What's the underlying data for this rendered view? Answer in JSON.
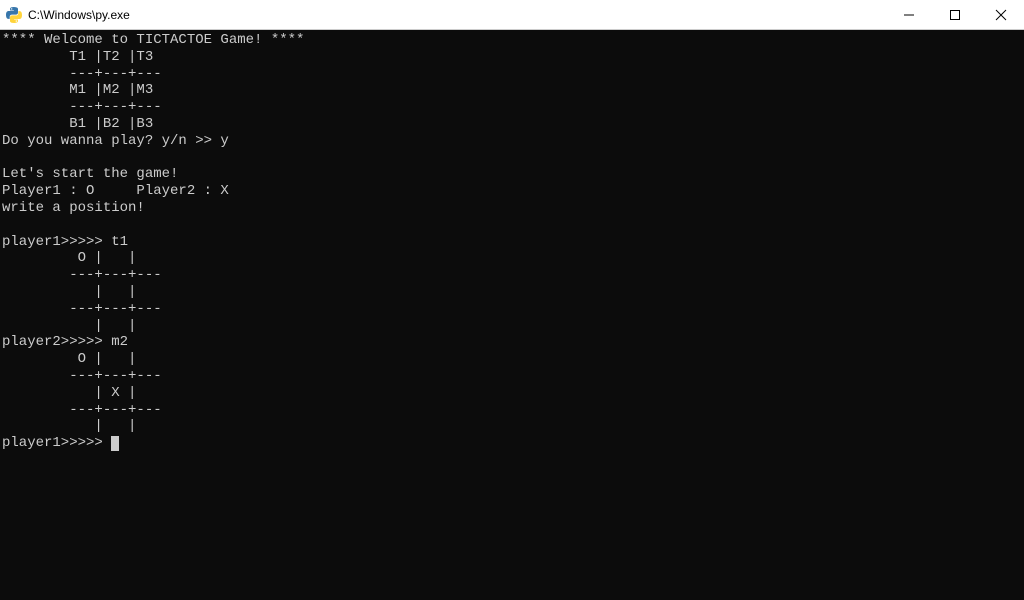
{
  "window": {
    "title": "C:\\Windows\\py.exe",
    "icon_name": "python-icon"
  },
  "console": {
    "lines": [
      "**** Welcome to TICTACTOE Game! ****",
      "        T1 |T2 |T3",
      "        ---+---+---",
      "        M1 |M2 |M3",
      "        ---+---+---",
      "        B1 |B2 |B3",
      "Do you wanna play? y/n >> y",
      "",
      "Let's start the game!",
      "Player1 : O     Player2 : X",
      "write a position!",
      "",
      "player1>>>>> t1",
      "         O |   |",
      "        ---+---+---",
      "           |   |",
      "        ---+---+---",
      "           |   |",
      "player2>>>>> m2",
      "         O |   |",
      "        ---+---+---",
      "           | X |",
      "        ---+---+---",
      "           |   |",
      "player1>>>>>"
    ]
  }
}
